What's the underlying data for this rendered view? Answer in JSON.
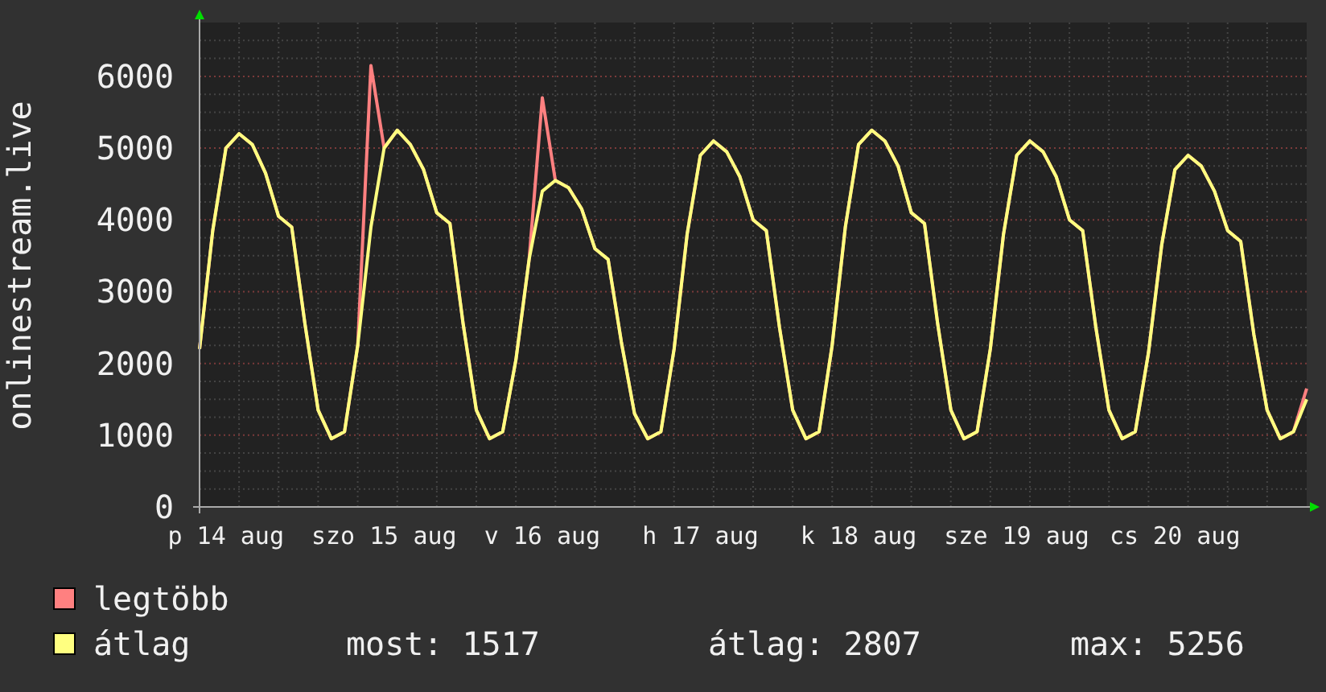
{
  "graph": {
    "chart_data": {
      "type": "line",
      "ylabel": "onlinestream.live",
      "ylim": [
        0,
        6750
      ],
      "grid": true,
      "yticks": [
        0,
        1000,
        2000,
        3000,
        4000,
        5000,
        6000
      ],
      "categories": [
        null,
        null,
        "p 14 aug",
        null,
        null,
        null,
        null,
        null,
        null,
        null,
        null,
        null,
        null,
        null,
        "szo 15 aug",
        null,
        null,
        null,
        null,
        null,
        null,
        null,
        null,
        null,
        null,
        null,
        "v 16 aug",
        null,
        null,
        null,
        null,
        null,
        null,
        null,
        null,
        null,
        null,
        null,
        "h 17 aug",
        null,
        null,
        null,
        null,
        null,
        null,
        null,
        null,
        null,
        null,
        null,
        "k 18 aug",
        null,
        null,
        null,
        null,
        null,
        null,
        null,
        null,
        null,
        null,
        null,
        "sze 19 aug",
        null,
        null,
        null,
        null,
        null,
        null,
        null,
        null,
        null,
        null,
        null,
        "cs 20 aug",
        null,
        null,
        null,
        null,
        null,
        null,
        null,
        null,
        null,
        null
      ],
      "series": [
        {
          "name": "legtöbb",
          "color": "#ff8080",
          "values": [
            2200,
            3850,
            5000,
            5200,
            5050,
            4650,
            4050,
            3900,
            2550,
            1350,
            950,
            1050,
            2250,
            6150,
            5000,
            5250,
            5050,
            4700,
            4100,
            3950,
            2550,
            1350,
            950,
            1050,
            2050,
            3450,
            5700,
            4550,
            4450,
            4150,
            3600,
            3450,
            2300,
            1300,
            950,
            1050,
            2200,
            3800,
            4900,
            5100,
            4950,
            4600,
            4000,
            3850,
            2500,
            1350,
            950,
            1050,
            2250,
            3900,
            5050,
            5250,
            5100,
            4750,
            4100,
            3950,
            2550,
            1350,
            950,
            1050,
            2200,
            3800,
            4900,
            5100,
            4950,
            4600,
            4000,
            3850,
            2500,
            1350,
            950,
            1050,
            2150,
            3650,
            4700,
            4900,
            4750,
            4400,
            3850,
            3700,
            2400,
            1350,
            950,
            1050,
            1650
          ]
        },
        {
          "name": "átlag",
          "color": "#ffff80",
          "values": [
            2200,
            3850,
            5000,
            5200,
            5050,
            4650,
            4050,
            3900,
            2550,
            1350,
            950,
            1050,
            2250,
            3900,
            5000,
            5250,
            5050,
            4700,
            4100,
            3950,
            2550,
            1350,
            950,
            1050,
            2050,
            3450,
            4400,
            4550,
            4450,
            4150,
            3600,
            3450,
            2300,
            1300,
            950,
            1050,
            2200,
            3800,
            4900,
            5100,
            4950,
            4600,
            4000,
            3850,
            2500,
            1350,
            950,
            1050,
            2250,
            3900,
            5050,
            5250,
            5100,
            4750,
            4100,
            3950,
            2550,
            1350,
            950,
            1050,
            2200,
            3800,
            4900,
            5100,
            4950,
            4600,
            4000,
            3850,
            2500,
            1350,
            950,
            1050,
            2150,
            3650,
            4700,
            4900,
            4750,
            4400,
            3850,
            3700,
            2400,
            1350,
            950,
            1050,
            1500
          ]
        }
      ]
    }
  },
  "stats": [
    "most: 1517",
    "átlag: 2807",
    "max: 5256"
  ]
}
